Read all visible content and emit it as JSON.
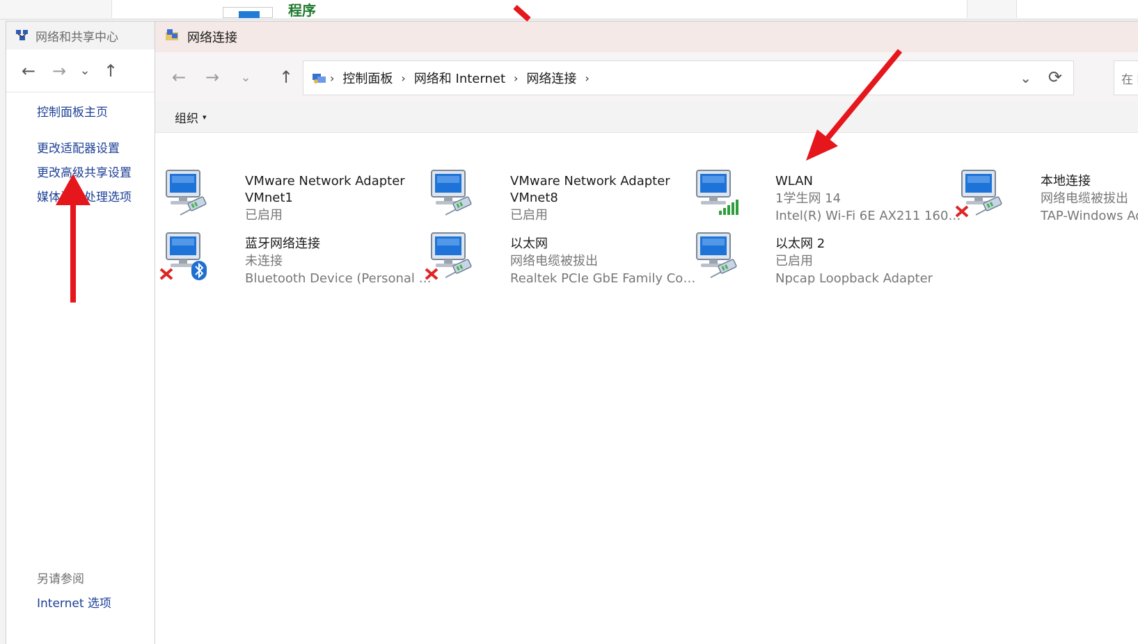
{
  "background": {
    "partial_text": "程序"
  },
  "left_window": {
    "title": "网络和共享中心",
    "nav": {
      "back": "←",
      "forward": "→",
      "recent": "⌄",
      "up": "↑"
    },
    "links": [
      "控制面板主页",
      "更改适配器设置",
      "更改高级共享设置",
      "媒体流式处理选项"
    ],
    "see_also_title": "另请参阅",
    "see_also_link": "Internet 选项"
  },
  "main_window": {
    "title": "网络连接",
    "nav": {
      "back": "←",
      "forward": "→",
      "recent": "⌄",
      "up": "↑"
    },
    "breadcrumb": [
      "控制面板",
      "网络和 Internet",
      "网络连接"
    ],
    "breadcrumb_sep": "›",
    "address_dropdown": "⌄",
    "refresh": "⟳",
    "search_placeholder": "在 网",
    "command_bar": {
      "organize": "组织",
      "organize_caret": "▾"
    },
    "connections": [
      {
        "name": "VMware Network Adapter",
        "line2": "VMnet1",
        "line3": "已启用",
        "status_icon": "network-cable",
        "disconnected": false
      },
      {
        "name": "VMware Network Adapter",
        "line2": "VMnet8",
        "line3": "已启用",
        "status_icon": "network-cable",
        "disconnected": false
      },
      {
        "name": "WLAN",
        "line2": "1学生网 14",
        "line3": "Intel(R) Wi-Fi 6E AX211 160M...",
        "status_icon": "wifi-signal",
        "disconnected": false
      },
      {
        "name": "本地连接",
        "line2": "网络电缆被拔出",
        "line3": "TAP-Windows Ada",
        "status_icon": "network-cable",
        "disconnected": true
      },
      {
        "name": "蓝牙网络连接",
        "line2": "未连接",
        "line3": "Bluetooth Device (Personal Are...",
        "status_icon": "bluetooth",
        "disconnected": true
      },
      {
        "name": "以太网",
        "line2": "网络电缆被拔出",
        "line3": "Realtek PCIe GbE Family Contr...",
        "status_icon": "network-cable",
        "disconnected": true
      },
      {
        "name": "以太网 2",
        "line2": "已启用",
        "line3": "Npcap Loopback Adapter",
        "status_icon": "network-cable",
        "disconnected": false
      }
    ]
  },
  "colors": {
    "link": "#1c3f95",
    "annotation_red": "#e5161c",
    "title_bar_tint": "#f4e9e7"
  }
}
